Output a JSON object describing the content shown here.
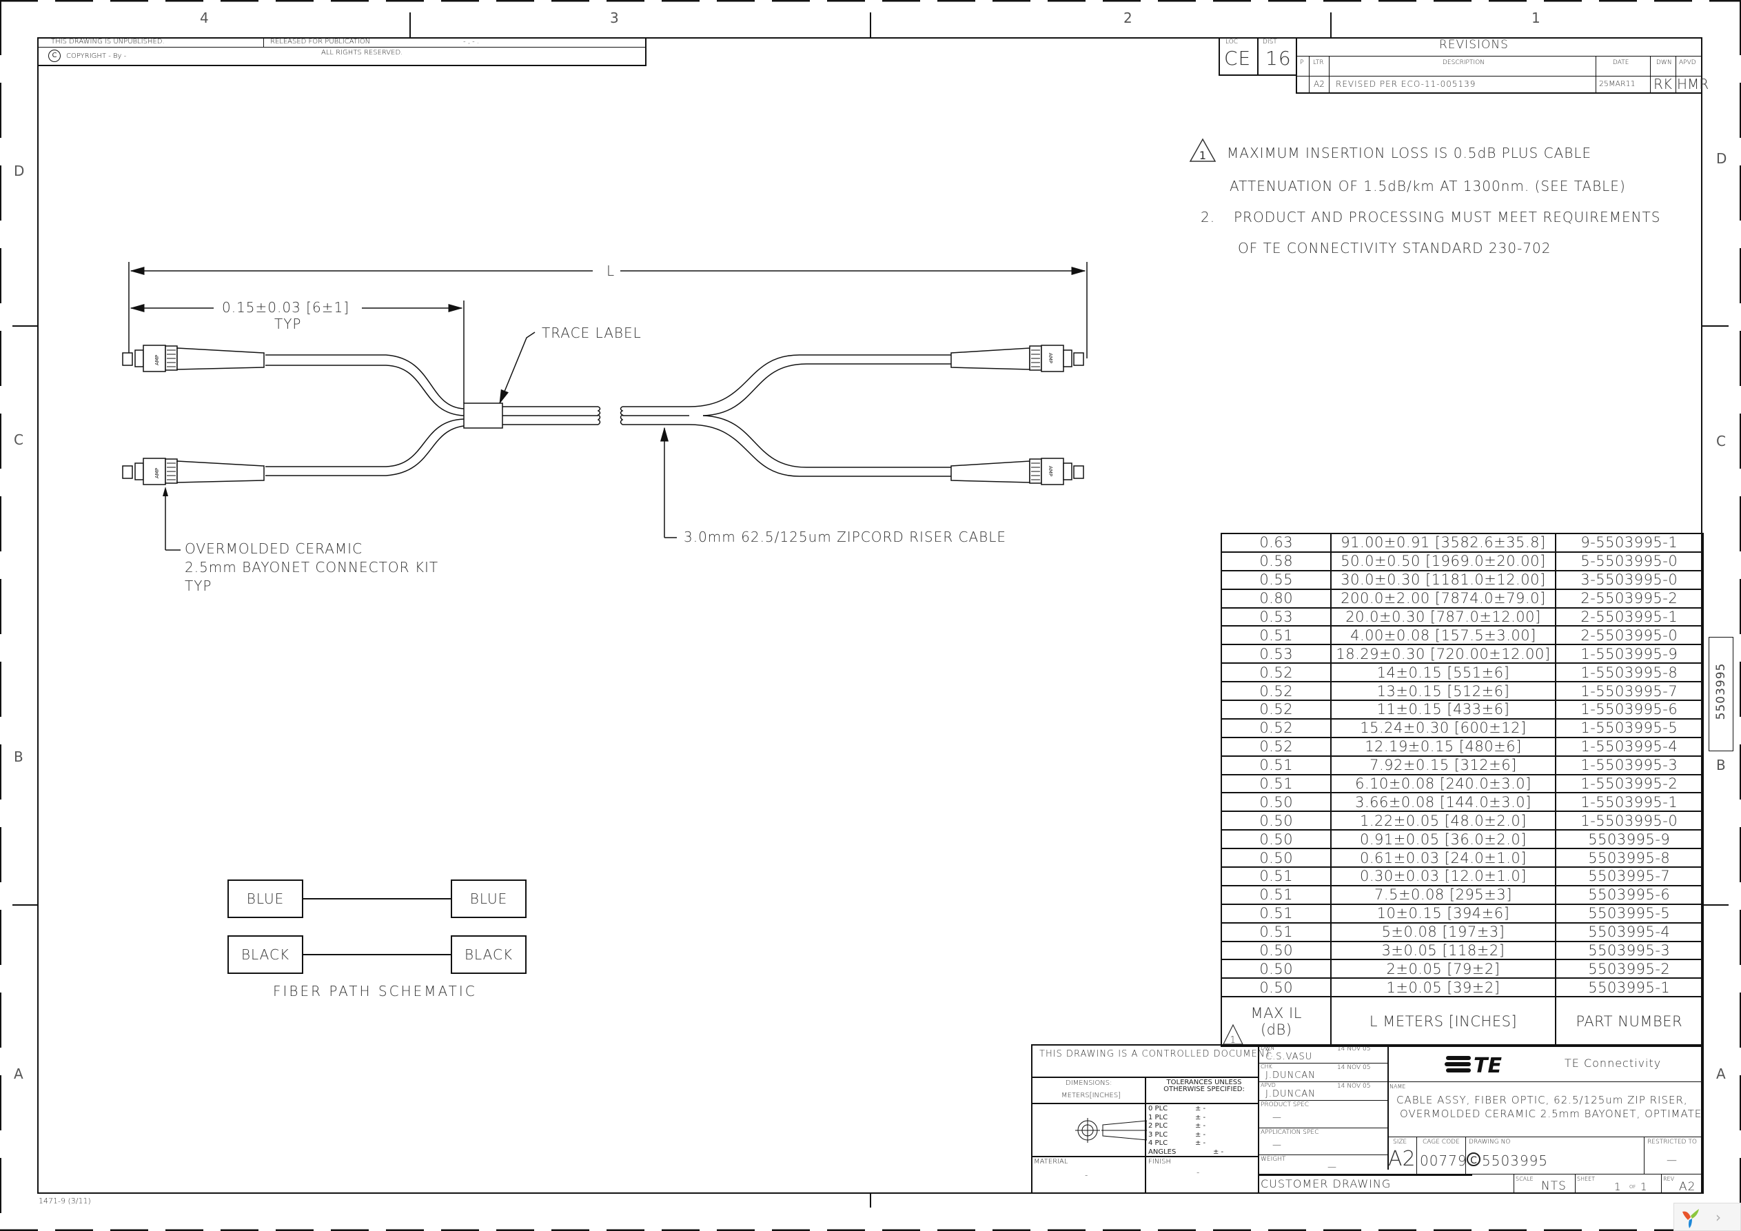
{
  "frame": {
    "zones_top": [
      "4",
      "3",
      "2",
      "1"
    ],
    "zones_side": [
      "D",
      "C",
      "B",
      "A"
    ],
    "side_part_number": "5503995",
    "form_number": "1471-9  (3/11)"
  },
  "top_strip": {
    "unpublished": "THIS DRAWING IS UNPUBLISHED.",
    "released": "RELEASED FOR PUBLICATION",
    "released_value": "- , -   .",
    "copyright": "COPYRIGHT  -    By  -",
    "rights": "ALL RIGHTS RESERVED."
  },
  "revisions": {
    "loc_label": "LOC",
    "loc_value": "CE",
    "dist_label": "DIST",
    "dist_value": "16",
    "title": "REVISIONS",
    "headers": [
      "P",
      "LTR",
      "DESCRIPTION",
      "DATE",
      "DWN",
      "APVD"
    ],
    "rows": [
      {
        "p": "",
        "ltr": "A2",
        "description": "REVISED PER ECO-11-005139",
        "date": "25MAR11",
        "dwn": "RK",
        "apvd": "HMR"
      }
    ]
  },
  "notes": [
    {
      "marker": "1",
      "line1": "MAXIMUM INSERTION LOSS IS 0.5dB PLUS CABLE",
      "line2": "ATTENUATION OF 1.5dB/km AT 1300nm. (SEE TABLE)"
    },
    {
      "marker": "2.",
      "line1": "PRODUCT AND PROCESSING MUST MEET REQUIREMENTS",
      "line2": "OF TE CONNECTIVITY STANDARD 230-702"
    }
  ],
  "drawing": {
    "dim_L": "L",
    "dim_breakout": "0.15±0.03 [6±1]",
    "dim_breakout_sub": "TYP",
    "trace_label": "TRACE LABEL",
    "connector_callout": [
      "OVERMOLDED CERAMIC",
      "2.5mm BAYONET CONNECTOR KIT",
      "TYP"
    ],
    "cable_callout": "3.0mm 62.5/125um ZIPCORD RISER CABLE",
    "connector_brand": "AMP"
  },
  "schematic": {
    "title": "FIBER PATH SCHEMATIC",
    "paths": [
      {
        "from": "BLUE",
        "to": "BLUE"
      },
      {
        "from": "BLACK",
        "to": "BLACK"
      }
    ]
  },
  "part_table": {
    "headers": {
      "il": "MAX IL",
      "il_unit": "(dB)",
      "il_marker": "1",
      "length": "L METERS [INCHES]",
      "part": "PART NUMBER"
    },
    "rows": [
      {
        "il": "0.63",
        "length": "91.00±0.91  [3582.6±35.8]",
        "part": "9-5503995-1"
      },
      {
        "il": "0.58",
        "length": "50.0±0.50  [1969.0±20.00]",
        "part": "5-5503995-0"
      },
      {
        "il": "0.55",
        "length": "30.0±0.30  [1181.0±12.00]",
        "part": "3-5503995-0"
      },
      {
        "il": "0.80",
        "length": "200.0±2.00  [7874.0±79.0]",
        "part": "2-5503995-2"
      },
      {
        "il": "0.53",
        "length": "20.0±0.30  [787.0±12.00]",
        "part": "2-5503995-1"
      },
      {
        "il": "0.51",
        "length": "4.00±0.08  [157.5±3.00]",
        "part": "2-5503995-0"
      },
      {
        "il": "0.53",
        "length": "18.29±0.30  [720.00±12.00]",
        "part": "1-5503995-9"
      },
      {
        "il": "0.52",
        "length": "14±0.15  [551±6]",
        "part": "1-5503995-8"
      },
      {
        "il": "0.52",
        "length": "13±0.15  [512±6]",
        "part": "1-5503995-7"
      },
      {
        "il": "0.52",
        "length": "11±0.15  [433±6]",
        "part": "1-5503995-6"
      },
      {
        "il": "0.52",
        "length": "15.24±0.30  [600±12]",
        "part": "1-5503995-5"
      },
      {
        "il": "0.52",
        "length": "12.19±0.15  [480±6]",
        "part": "1-5503995-4"
      },
      {
        "il": "0.51",
        "length": "7.92±0.15  [312±6]",
        "part": "1-5503995-3"
      },
      {
        "il": "0.51",
        "length": "6.10±0.08  [240.0±3.0]",
        "part": "1-5503995-2"
      },
      {
        "il": "0.50",
        "length": "3.66±0.08  [144.0±3.0]",
        "part": "1-5503995-1"
      },
      {
        "il": "0.50",
        "length": "1.22±0.05  [48.0±2.0]",
        "part": "1-5503995-0"
      },
      {
        "il": "0.50",
        "length": "0.91±0.05  [36.0±2.0]",
        "part": "5503995-9"
      },
      {
        "il": "0.50",
        "length": "0.61±0.03  [24.0±1.0]",
        "part": "5503995-8"
      },
      {
        "il": "0.51",
        "length": "0.30±0.03  [12.0±1.0]",
        "part": "5503995-7"
      },
      {
        "il": "0.51",
        "length": "7.5±0.08  [295±3]",
        "part": "5503995-6"
      },
      {
        "il": "0.51",
        "length": "10±0.15  [394±6]",
        "part": "5503995-5"
      },
      {
        "il": "0.51",
        "length": "5±0.08  [197±3]",
        "part": "5503995-4"
      },
      {
        "il": "0.50",
        "length": "3±0.05  [118±2]",
        "part": "5503995-3"
      },
      {
        "il": "0.50",
        "length": "2±0.05  [79±2]",
        "part": "5503995-2"
      },
      {
        "il": "0.50",
        "length": "1±0.05  [39±2]",
        "part": "5503995-1"
      }
    ]
  },
  "title_block": {
    "controlled": "THIS DRAWING IS A CONTROLLED DOCUMENT.",
    "dimensions_label": "DIMENSIONS:",
    "dimensions_value": "METERS[INCHES]",
    "tolerances_label": "TOLERANCES UNLESS OTHERWISE SPECIFIED:",
    "tolerances": [
      {
        "label": "0  PLC",
        "value": "±  -"
      },
      {
        "label": "1  PLC",
        "value": "±  -"
      },
      {
        "label": "2  PLC",
        "value": "±  -"
      },
      {
        "label": "3  PLC",
        "value": "±  -"
      },
      {
        "label": "4  PLC",
        "value": "±  -"
      },
      {
        "label": "ANGLES",
        "value": "±  -"
      }
    ],
    "material_label": "MATERIAL",
    "material_value": "-",
    "finish_label": "FINISH",
    "finish_value": "-",
    "dwn_label": "DWN",
    "dwn_name": "C.S.VASU",
    "dwn_date": "14 NOV 05",
    "chk_label": "CHK",
    "chk_name": "J.DUNCAN",
    "chk_date": "14 NOV 05",
    "apvd_label": "APVD",
    "apvd_name": "J.DUNCAN",
    "apvd_date": "14 NOV 05",
    "product_spec_label": "PRODUCT SPEC",
    "product_spec_value": "—",
    "application_spec_label": "APPLICATION SPEC",
    "application_spec_value": "—",
    "weight_label": "WEIGHT",
    "weight_value": "—",
    "customer_drawing": "CUSTOMER DRAWING",
    "company": "TE Connectivity",
    "logo_text": "TE",
    "name_label": "NAME",
    "name_line1": "CABLE ASSY, FIBER OPTIC, 62.5/125um ZIP RISER,",
    "name_line2": "OVERMOLDED CERAMIC 2.5mm BAYONET, OPTIMATE",
    "size_label": "SIZE",
    "size_value": "A2",
    "cage_label": "CAGE CODE",
    "cage_value": "00779",
    "dwg_label": "DRAWING NO",
    "dwg_prefix": "C",
    "dwg_value": "5503995",
    "restricted_label": "RESTRICTED TO",
    "restricted_value": "—",
    "scale_label": "SCALE",
    "scale_value": "NTS",
    "sheet_label": "SHEET",
    "sheet_value": "1",
    "sheet_of": "OF",
    "sheet_total": "1",
    "rev_label": "REV",
    "rev_value": "A2"
  },
  "viewer": {
    "next_label": "›"
  }
}
